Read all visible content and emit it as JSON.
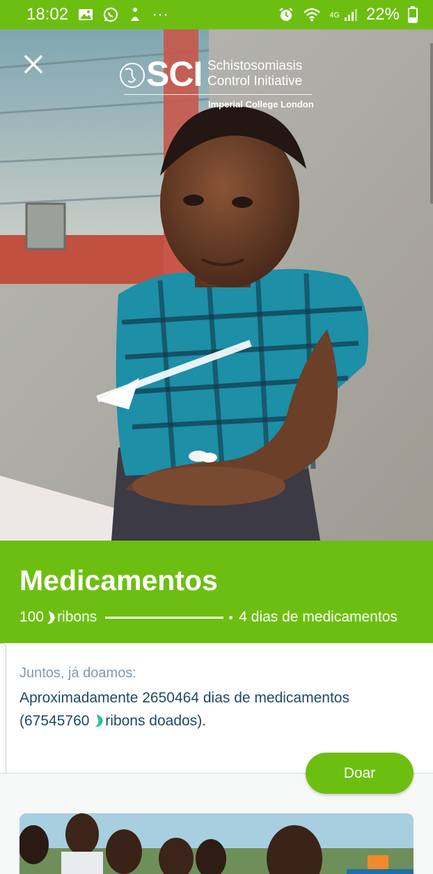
{
  "status_bar": {
    "time": "18:02",
    "more": "···",
    "network": "4G",
    "battery": "22%",
    "icons": [
      "gallery-icon",
      "whatsapp-icon",
      "app-icon",
      "alarm-icon",
      "wifi-icon",
      "signal-icon",
      "battery-icon"
    ]
  },
  "hero": {
    "close_icon": "close-icon",
    "logo": {
      "abbr": "SCI",
      "name_line1": "Schistosomiasis",
      "name_line2": "Control Initiative",
      "affiliation": "Imperial College London"
    }
  },
  "header": {
    "title": "Medicamentos",
    "cost_value": "100",
    "currency_suffix": "ribons",
    "result_text": "4 dias de medicamentos"
  },
  "summary": {
    "label": "Juntos, já doamos:",
    "line1": "Aproximadamente 2650464 dias de medicamentos",
    "line2_prefix": "(67545760",
    "line2_suffix": "ribons doados)."
  },
  "actions": {
    "donate_label": "Doar"
  },
  "colors": {
    "brand_green": "#6cbf10",
    "text_dark": "#1e4a64",
    "label_muted": "#7d9bb5",
    "ribon_teal": "#2bbf9a"
  }
}
